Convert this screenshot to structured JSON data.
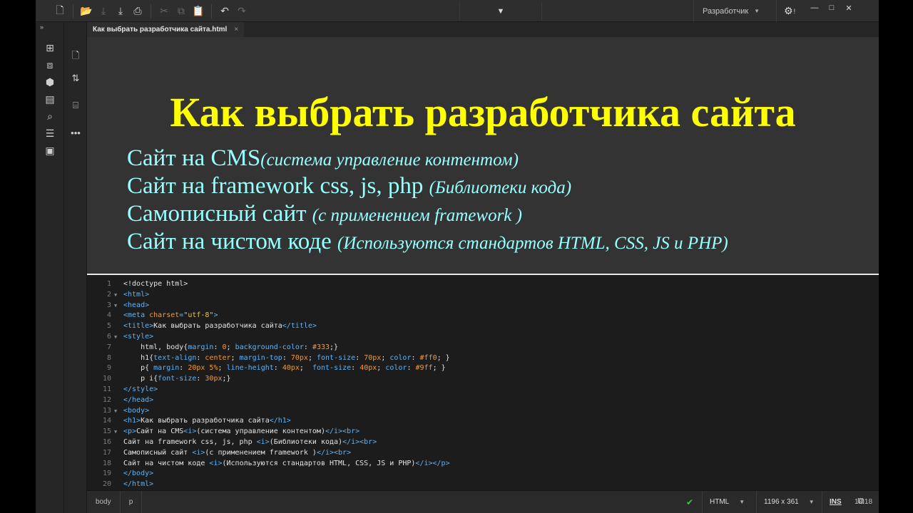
{
  "toolbar": {
    "icons": [
      "new-file-icon",
      "open-folder-icon",
      "save-icon",
      "save-all-icon",
      "print-icon",
      "cut-icon",
      "copy-icon",
      "paste-icon",
      "undo-icon",
      "redo-icon"
    ],
    "workspace_label": "Разработчик"
  },
  "document_tab": {
    "title": "Как выбрать разработчика сайта.html",
    "close": "×"
  },
  "live_view": {
    "h1": "Как выбрать разработчика сайта",
    "lines": [
      {
        "main": "Сайт на CMS",
        "italic": "(система управление контентом)"
      },
      {
        "main": "Сайт на framework css, js, php ",
        "italic": "(Библиотеки кода)"
      },
      {
        "main": "Самописный сайт ",
        "italic": "(с применением framework )"
      },
      {
        "main": "Сайт на чистом коде ",
        "italic": "(Используются стандартов HTML, CSS, JS и PHP)"
      }
    ]
  },
  "code_view": {
    "line_numbers": [
      "1",
      "2",
      "3",
      "4",
      "5",
      "6",
      "7",
      "8",
      "9",
      "10",
      "11",
      "12",
      "13",
      "14",
      "15",
      "16",
      "17",
      "18",
      "19",
      "20"
    ],
    "folded_lines": [
      2,
      3,
      6,
      13,
      15
    ],
    "lines": [
      [
        [
          "txt",
          "<!doctype html>"
        ]
      ],
      [
        [
          "tag",
          "<html>"
        ]
      ],
      [
        [
          "tag",
          "<head>"
        ]
      ],
      [
        [
          "tag",
          "<meta "
        ],
        [
          "attr",
          "charset"
        ],
        [
          "tag",
          "="
        ],
        [
          "str",
          "\"utf-8\""
        ],
        [
          "tag",
          ">"
        ]
      ],
      [
        [
          "tag",
          "<title>"
        ],
        [
          "txt",
          "Как выбрать разработчика сайта"
        ],
        [
          "tag",
          "</title>"
        ]
      ],
      [
        [
          "tag",
          "<style>"
        ]
      ],
      [
        [
          "txt",
          "    html, body{"
        ],
        [
          "prop",
          "margin"
        ],
        [
          "txt",
          ": "
        ],
        [
          "val",
          "0"
        ],
        [
          "txt",
          "; "
        ],
        [
          "prop",
          "background-color"
        ],
        [
          "txt",
          ": "
        ],
        [
          "val",
          "#333"
        ],
        [
          "txt",
          ";}"
        ]
      ],
      [
        [
          "txt",
          "    h1{"
        ],
        [
          "prop",
          "text-align"
        ],
        [
          "txt",
          ": "
        ],
        [
          "val",
          "center"
        ],
        [
          "txt",
          "; "
        ],
        [
          "prop",
          "margin-top"
        ],
        [
          "txt",
          ": "
        ],
        [
          "val",
          "70px"
        ],
        [
          "txt",
          "; "
        ],
        [
          "prop",
          "font-size"
        ],
        [
          "txt",
          ": "
        ],
        [
          "val",
          "70px"
        ],
        [
          "txt",
          "; "
        ],
        [
          "prop",
          "color"
        ],
        [
          "txt",
          ": "
        ],
        [
          "val",
          "#ff0"
        ],
        [
          "txt",
          "; }"
        ]
      ],
      [
        [
          "txt",
          "    p{ "
        ],
        [
          "prop",
          "margin"
        ],
        [
          "txt",
          ": "
        ],
        [
          "val",
          "20px 5%"
        ],
        [
          "txt",
          "; "
        ],
        [
          "prop",
          "line-height"
        ],
        [
          "txt",
          ": "
        ],
        [
          "val",
          "40px"
        ],
        [
          "txt",
          ";  "
        ],
        [
          "prop",
          "font-size"
        ],
        [
          "txt",
          ": "
        ],
        [
          "val",
          "40px"
        ],
        [
          "txt",
          "; "
        ],
        [
          "prop",
          "color"
        ],
        [
          "txt",
          ": "
        ],
        [
          "val",
          "#9ff"
        ],
        [
          "txt",
          "; }"
        ]
      ],
      [
        [
          "txt",
          "    p i{"
        ],
        [
          "prop",
          "font-size"
        ],
        [
          "txt",
          ": "
        ],
        [
          "val",
          "30px"
        ],
        [
          "txt",
          ";}"
        ]
      ],
      [
        [
          "tag",
          "</style>"
        ]
      ],
      [
        [
          "tag",
          "</head>"
        ]
      ],
      [
        [
          "tag",
          "<body>"
        ]
      ],
      [
        [
          "tag",
          "<h1>"
        ],
        [
          "txt",
          "Как выбрать разработчика сайта"
        ],
        [
          "tag",
          "</h1>"
        ]
      ],
      [
        [
          "tag",
          "<p>"
        ],
        [
          "txt",
          "Сайт на CMS"
        ],
        [
          "tag",
          "<i>"
        ],
        [
          "txt",
          "(система управление контентом)"
        ],
        [
          "tag",
          "</i><br>"
        ]
      ],
      [
        [
          "txt",
          "Сайт на framework css, js, php "
        ],
        [
          "tag",
          "<i>"
        ],
        [
          "txt",
          "(Библиотеки кода)"
        ],
        [
          "tag",
          "</i><br>"
        ]
      ],
      [
        [
          "txt",
          "Самописный сайт "
        ],
        [
          "tag",
          "<i>"
        ],
        [
          "txt",
          "(с применением framework )"
        ],
        [
          "tag",
          "</i><br>"
        ]
      ],
      [
        [
          "txt",
          "Сайт на чистом коде "
        ],
        [
          "tag",
          "<i>"
        ],
        [
          "txt",
          "(Используются стандартов HTML, CSS, JS и PHP)"
        ],
        [
          "tag",
          "</i></p>"
        ]
      ],
      [
        [
          "tag",
          "</body>"
        ]
      ],
      [
        [
          "tag",
          "</html>"
        ]
      ]
    ]
  },
  "status_bar": {
    "breadcrumbs": [
      "body",
      "p"
    ],
    "doc_type": "HTML",
    "window_size": "1196 x 361",
    "insert_mode": "INS",
    "cursor_position": "18:18"
  },
  "colors": {
    "h1": "#ffff00",
    "paragraph": "#99ffff",
    "live_background": "#333333",
    "code_tag": "#5fb3f6",
    "code_value": "#f09a3e"
  }
}
